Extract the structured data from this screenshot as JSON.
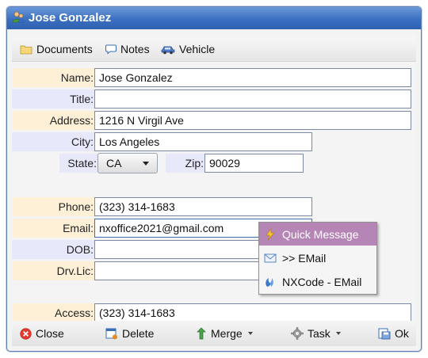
{
  "window": {
    "title": "Jose Gonzalez"
  },
  "toolbar": {
    "documents": "Documents",
    "notes": "Notes",
    "vehicle": "Vehicle"
  },
  "form": {
    "name_label": "Name:",
    "name_value": "Jose Gonzalez",
    "title_label": "Title:",
    "title_value": "",
    "address_label": "Address:",
    "address_value": "1216 N Virgil Ave",
    "city_label": "City:",
    "city_value": "Los Angeles",
    "state_label": "State:",
    "state_value": "CA",
    "zip_label": "Zip:",
    "zip_value": "90029",
    "phone_label": "Phone:",
    "phone_value": "(323) 314-1683",
    "email_label": "Email:",
    "email_value": "nxoffice2021@gmail.com",
    "dob_label": "DOB:",
    "dob_value": "",
    "drvlic_label": "Drv.Lic:",
    "drvlic_value": "",
    "access_label": "Access:",
    "access_value": "(323) 314-1683"
  },
  "bottombar": {
    "close": "Close",
    "delete": "Delete",
    "merge": "Merge",
    "task": "Task",
    "ok": "Ok"
  },
  "popup": {
    "items": [
      "Quick Message",
      ">> EMail",
      "NXCode - EMail"
    ]
  },
  "colors": {
    "title_bar": "#3b6fc0",
    "label_peach": "#fdf0d7",
    "label_lavender": "#e7e8fa",
    "popup_highlight": "#b585b5"
  }
}
